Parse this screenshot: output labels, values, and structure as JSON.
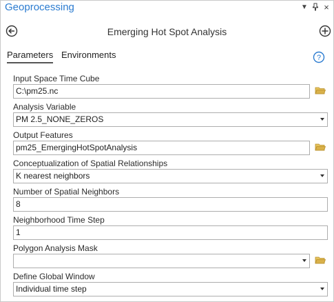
{
  "pane": {
    "title": "Geoprocessing",
    "menu_icon": "dropdown-menu-icon",
    "pin_icon": "pin-icon",
    "close_icon": "close-icon"
  },
  "header": {
    "tool_title": "Emerging Hot Spot Analysis",
    "back_icon": "back-arrow-icon",
    "add_icon": "add-icon"
  },
  "tabs": [
    {
      "label": "Parameters",
      "active": true
    },
    {
      "label": "Environments",
      "active": false
    }
  ],
  "help_icon": "help-icon",
  "parameters": [
    {
      "label": "Input Space Time Cube",
      "value": "C:\\pm25.nc",
      "type": "file"
    },
    {
      "label": "Analysis Variable",
      "value": "PM 2.5_NONE_ZEROS",
      "type": "dropdown"
    },
    {
      "label": "Output Features",
      "value": "pm25_EmergingHotSpotAnalysis",
      "type": "file"
    },
    {
      "label": "Conceptualization of Spatial Relationships",
      "value": "K nearest neighbors",
      "type": "dropdown"
    },
    {
      "label": "Number of Spatial Neighbors",
      "value": "8",
      "type": "text"
    },
    {
      "label": "Neighborhood Time Step",
      "value": "1",
      "type": "text"
    },
    {
      "label": "Polygon Analysis Mask",
      "value": "",
      "type": "dropdown-file"
    },
    {
      "label": "Define Global Window",
      "value": "Individual time step",
      "type": "dropdown"
    }
  ],
  "colors": {
    "accent": "#2a7bd0",
    "folder": "#d9b14a"
  }
}
